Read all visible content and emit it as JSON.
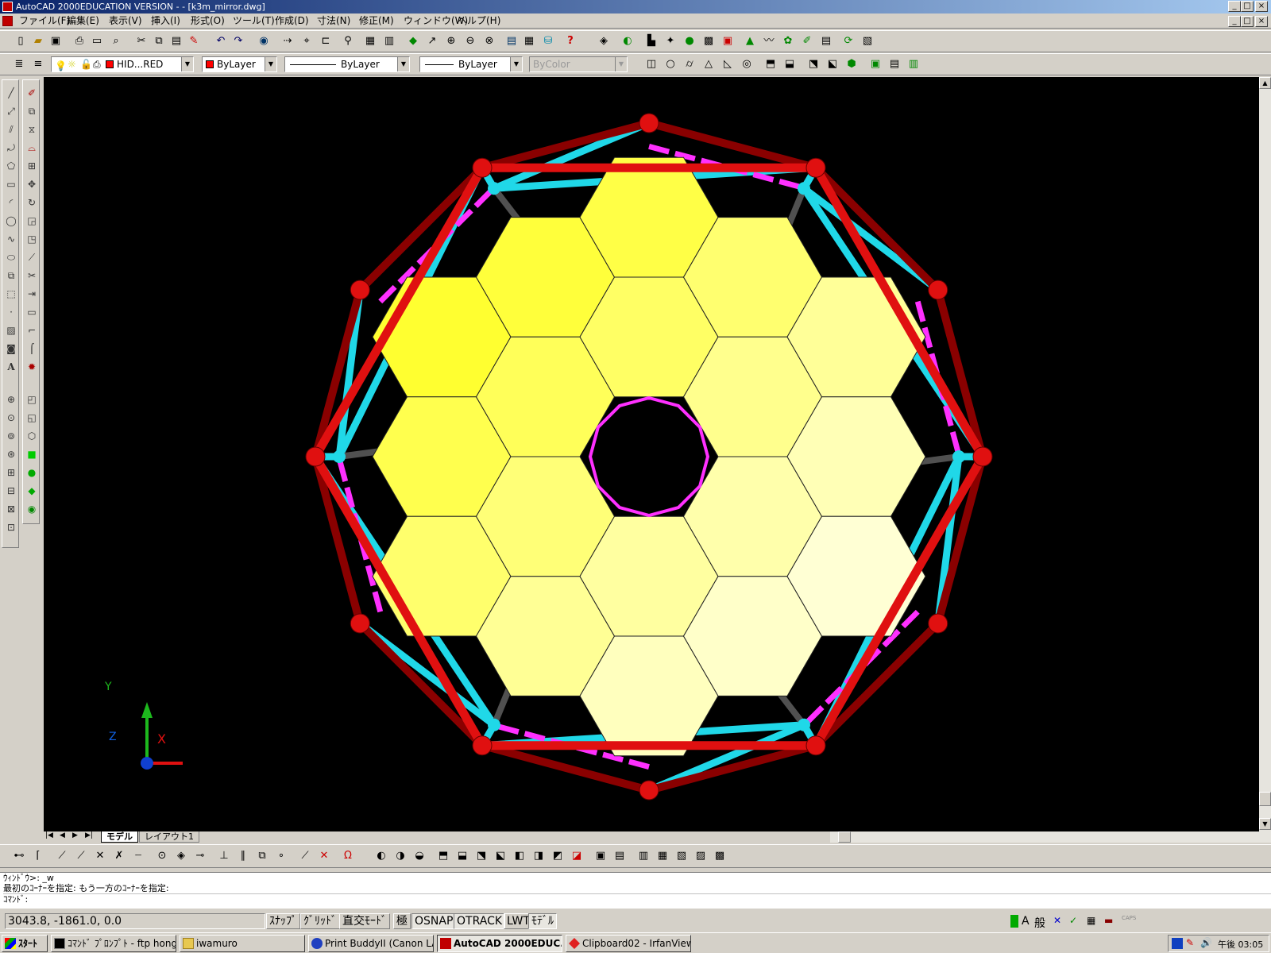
{
  "window": {
    "title": "AutoCAD 2000EDUCATION VERSION - - [k3m_mirror.dwg]",
    "controls": [
      "_",
      "□",
      "×"
    ]
  },
  "menu": [
    "ファイル(F)",
    "編集(E)",
    "表示(V)",
    "挿入(I)",
    "形式(O)",
    "ツール(T)",
    "作成(D)",
    "寸法(N)",
    "修正(M)",
    "ウィンドウ(W)",
    "ヘルプ(H)"
  ],
  "properties": {
    "layer": "HID...RED",
    "color": "ByLayer",
    "linetype": "ByLayer",
    "lineweight": "ByLayer",
    "plotstyle": "ByColor"
  },
  "ucs": {
    "x_label": "X",
    "y_label": "Y",
    "z_label": "Z"
  },
  "tabs": [
    "モデル",
    "レイアウト1"
  ],
  "command": {
    "line1": "ｳｨﾝﾄﾞｳ>:  _w",
    "line2": "最初のｺｰﾅｰを指定: もう一方のｺｰﾅｰを指定:",
    "prompt": "ｺﾏﾝﾄﾞ:"
  },
  "status": {
    "coords": "3043.8, -1861.0, 0.0",
    "buttons": [
      "ｽﾅｯﾌﾟ",
      "ｸﾞﾘｯﾄﾞ",
      "直交ﾓｰﾄﾞ",
      "極",
      "OSNAP",
      "OTRACK",
      "LWT",
      "ﾓﾃﾞﾙ"
    ]
  },
  "tray_badges": [
    "A",
    "般"
  ],
  "taskbar": {
    "start": "ｽﾀｰﾄ",
    "tasks": [
      "ｺﾏﾝﾄﾞ ﾌﾟﾛﾝﾌﾟﾄ - ftp hong...",
      "iwamuro",
      "Print BuddyII (Canon LA...",
      "AutoCAD 2000EDUC...",
      "Clipboard02 - IrfanView"
    ],
    "clock": "午後 03:05"
  },
  "colors": {
    "frame": "#e01010",
    "strut": "#20d8e8",
    "rib": "#ff30ff",
    "mirror": "#ffff40",
    "background": "#000000"
  }
}
